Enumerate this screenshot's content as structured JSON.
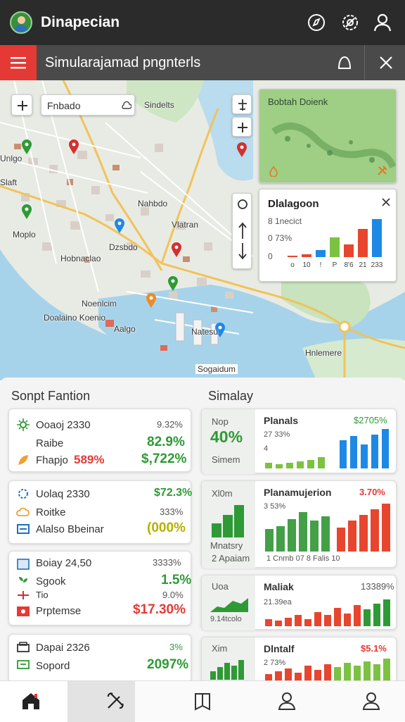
{
  "app": {
    "title": "Dinapecian"
  },
  "subbar": {
    "title": "Simularajamad pngnterls"
  },
  "map": {
    "search_text": "Fnbado",
    "labels": [
      "Sindelts",
      "Nahbdo",
      "Vlatran",
      "Dzsbdo",
      "Hobnaclao",
      "Noenlcim",
      "Doalaino Koenio",
      "Aalgo",
      "Natesu",
      "Sogaidum",
      "Moplo",
      "Unlgo",
      "Slaft",
      "Hnlemere"
    ],
    "mini_map_title": "Bobtah Doienk",
    "mini_chart": {
      "title": "Dlalagoon",
      "label1": "8 1necict",
      "label2": "0 73%",
      "label3": "0"
    }
  },
  "chart_data": {
    "type": "bar",
    "categories": [
      "o",
      "10",
      "!",
      "P",
      "8'6",
      "21",
      "233"
    ],
    "values": [
      1,
      2,
      5,
      14,
      9,
      20,
      27
    ],
    "title": "Dlalagoon",
    "xlabel": "",
    "ylabel": "",
    "ylim": [
      0,
      30
    ]
  },
  "left_section": {
    "title": "Sonpt Fantion"
  },
  "right_section": {
    "title": "Simalay"
  },
  "left_cards": [
    {
      "row1_label": "Ooaoj 2330",
      "row1_value": "9.32%",
      "row2_label": "Raibe",
      "row2_value": "82.9%",
      "row3_label": "Fhapjo",
      "row3_badge": "589%",
      "row3_value": "$,722%"
    },
    {
      "row1_label": "Uolaq 2330",
      "row1_value": "$72.3%",
      "row2_label": "Roitke",
      "row2_value": "333%",
      "row3_label": "Alalso Bbeinar",
      "row3_value": "(000%"
    },
    {
      "row1_label": "Boiay 24,50",
      "row1_value": "3333%",
      "row2_label": "Sgook",
      "row2_value": "1.5%",
      "row3_label": "Tio",
      "row3_value": "9.0%",
      "row4_label": "Prptemse",
      "row4_value": "$17.30%"
    },
    {
      "row1_label": "Dapai 2326",
      "row1_value": "3%",
      "row2_label": "Sopord",
      "row2_value": "2097%"
    }
  ],
  "right_cards": [
    {
      "side_label": "Nop",
      "side_value": "40%",
      "side_sub": "Simem",
      "title": "Planals",
      "value": "$2705%",
      "line1": "27 33%",
      "line2": "4"
    },
    {
      "side_label": "Xl0m",
      "side_sub": "Mnatsry",
      "side_sub2": "2 Apaiam",
      "title": "Planamujerion",
      "value": "3.70%",
      "line1": "3 53%",
      "axis": "1   Cnmb   07   8   Falis   10"
    },
    {
      "side_label": "Uoa",
      "side_sub": "9.14tcolo",
      "title": "Maliak",
      "value": "13389%",
      "line1": "21.39ea"
    },
    {
      "side_label": "Xim",
      "title": "Dlntalf",
      "value": "$5.1%",
      "line1": "2 73%"
    }
  ],
  "bottom_nav": [
    "home",
    "tools",
    "book",
    "profile",
    "account"
  ]
}
